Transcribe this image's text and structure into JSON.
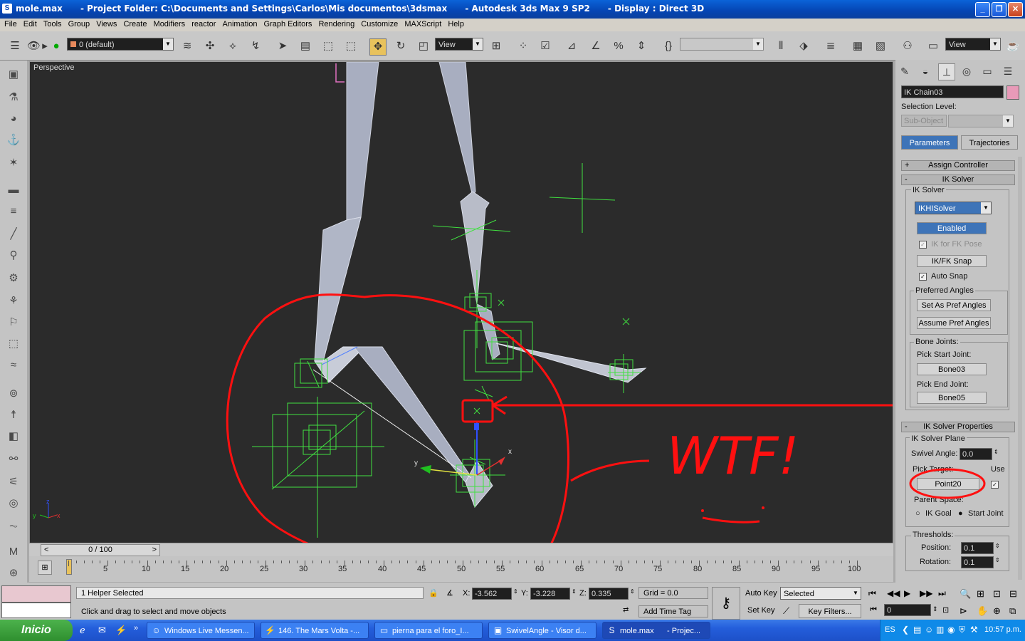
{
  "window": {
    "title": "mole.max      - Project Folder: C:\\Documents and Settings\\Carlos\\Mis documentos\\3dsmax      - Autodesk 3ds Max 9 SP2      - Display : Direct 3D",
    "minimize": "_",
    "maximize": "❐",
    "close": "✕"
  },
  "menu": [
    "File",
    "Edit",
    "Tools",
    "Group",
    "Views",
    "Create",
    "Modifiers",
    "reactor",
    "Animation",
    "Graph Editors",
    "Rendering",
    "Customize",
    "MAXScript",
    "Help"
  ],
  "toolbar": {
    "layer_value": "0 (default)",
    "ref_coord_1": "View",
    "ref_coord_2": "View",
    "selection_set": ""
  },
  "viewport": {
    "label": "Perspective",
    "annotation": "WTF!",
    "axis_y": "y",
    "axis_x": "x",
    "axis_z": "z"
  },
  "timeline": {
    "frame_display": "0 / 100",
    "ticks": [
      "5",
      "10",
      "15",
      "20",
      "25",
      "30",
      "35",
      "40",
      "45",
      "50",
      "55",
      "60",
      "65",
      "70",
      "75",
      "80",
      "85",
      "90",
      "95",
      "100"
    ]
  },
  "status": {
    "selected_text": "1 Helper Selected",
    "prompt": "Click and drag to select and move objects",
    "x_label": "X:",
    "x_value": "-3.562",
    "y_label": "Y:",
    "y_value": "-3.228",
    "z_label": "Z:",
    "z_value": "0.335",
    "grid": "Grid = 0.0",
    "add_time_tag": "Add Time Tag",
    "auto_key": "Auto Key",
    "set_key": "Set Key",
    "key_mode": "Selected",
    "key_filters": "Key Filters...",
    "current_frame": "0"
  },
  "panel": {
    "object_name": "IK Chain03",
    "object_color": "#e89ab8",
    "selection_level": "Selection Level:",
    "sub_object": "Sub-Object",
    "tab_parameters": "Parameters",
    "tab_trajectories": "Trajectories",
    "assign_controller": "Assign Controller",
    "ik_solver_rollout": "IK Solver",
    "ik_solver_group": "IK Solver",
    "solver_type": "IKHISolver",
    "enabled": "Enabled",
    "ik_for_fk_pose": "IK for FK Pose",
    "ik_fk_snap": "IK/FK Snap",
    "auto_snap": "Auto Snap",
    "preferred_angles": "Preferred Angles",
    "set_pref": "Set As Pref Angles",
    "assume_pref": "Assume Pref Angles",
    "bone_joints": "Bone Joints:",
    "pick_start": "Pick Start Joint:",
    "start_joint": "Bone03",
    "pick_end": "Pick End Joint:",
    "end_joint": "Bone05",
    "ik_props_rollout": "IK Solver Properties",
    "solver_plane": "IK Solver Plane",
    "swivel_label": "Swivel Angle:",
    "swivel_value": "0.0",
    "pick_target": "Pick Target:",
    "use": "Use",
    "target": "Point20",
    "parent_space": "Parent Space:",
    "ik_goal": "IK Goal",
    "start_joint_radio": "Start Joint",
    "thresholds": "Thresholds:",
    "position_label": "Position:",
    "position_value": "0.1",
    "rotation_label": "Rotation:",
    "rotation_value": "0.1"
  },
  "taskbar": {
    "start": "Inicio",
    "tasks": [
      {
        "label": "Windows Live Messen...",
        "icon": "messenger-icon"
      },
      {
        "label": "146. The Mars Volta -...",
        "icon": "winamp-icon"
      },
      {
        "label": "pierna para el foro_I...",
        "icon": "folder-icon"
      },
      {
        "label": "SwivelAngle - Visor d...",
        "icon": "image-viewer-icon"
      },
      {
        "label": "mole.max      - Projec...",
        "icon": "3dsmax-icon"
      }
    ],
    "lang": "ES",
    "clock": "10:57 p.m."
  }
}
